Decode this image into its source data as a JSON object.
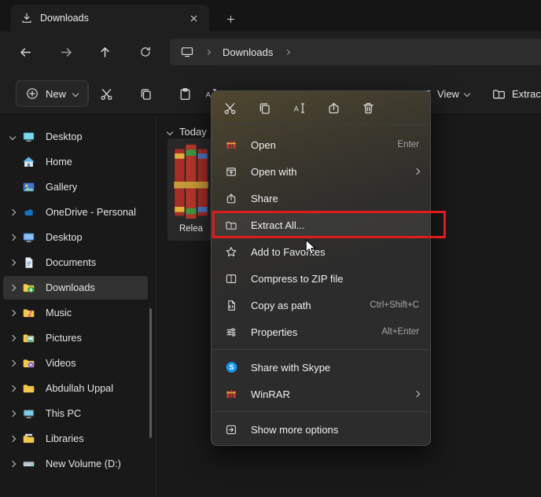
{
  "tab": {
    "title": "Downloads"
  },
  "nav": {
    "location": "Downloads"
  },
  "toolbar": {
    "new_label": "New",
    "view_label": "View",
    "extract_all_label": "Extract all"
  },
  "sidebar": {
    "items": [
      {
        "label": "Desktop"
      },
      {
        "label": "Home"
      },
      {
        "label": "Gallery"
      },
      {
        "label": "OneDrive - Personal"
      },
      {
        "label": "Desktop"
      },
      {
        "label": "Documents"
      },
      {
        "label": "Downloads"
      },
      {
        "label": "Music"
      },
      {
        "label": "Pictures"
      },
      {
        "label": "Videos"
      },
      {
        "label": "Abdullah Uppal"
      },
      {
        "label": "This PC"
      },
      {
        "label": "Libraries"
      },
      {
        "label": "New Volume (D:)"
      }
    ]
  },
  "content": {
    "group_label": "Today",
    "file_label": "Relea"
  },
  "menu": {
    "items": [
      {
        "label": "Open",
        "shortcut": "Enter"
      },
      {
        "label": "Open with",
        "submenu": true
      },
      {
        "label": "Share"
      },
      {
        "label": "Extract All...",
        "highlighted": true
      },
      {
        "label": "Add to Favorites"
      },
      {
        "label": "Compress to ZIP file"
      },
      {
        "label": "Copy as path",
        "shortcut": "Ctrl+Shift+C"
      },
      {
        "label": "Properties",
        "shortcut": "Alt+Enter"
      },
      {
        "label": "Share with Skype"
      },
      {
        "label": "WinRAR",
        "submenu": true
      },
      {
        "label": "Show more options"
      }
    ]
  },
  "colors": {
    "annotation_red": "#e01b1b",
    "menu_bg": "#2c2c2c",
    "selection_bg": "#323232"
  }
}
